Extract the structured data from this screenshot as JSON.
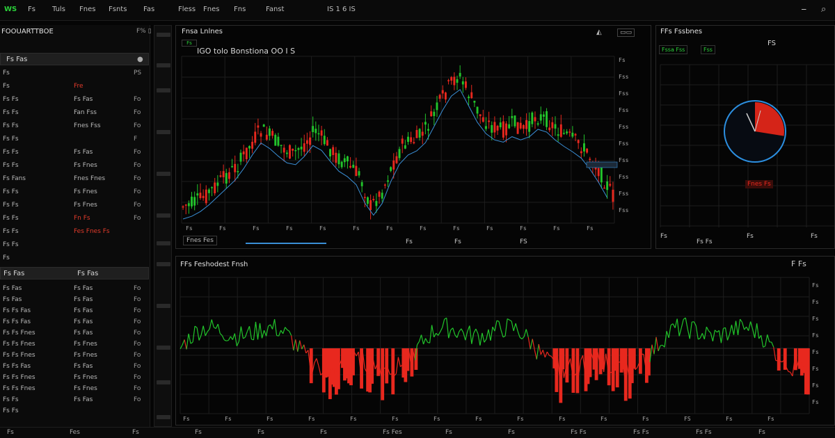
{
  "colors": {
    "up": "#22c52b",
    "down": "#e8281e",
    "accent": "#3a8fd6",
    "panel_border": "#2a2a2a"
  },
  "topbar": {
    "app_label": "WS",
    "menu": [
      "Fs",
      "Tuls",
      "Fnes",
      "Fsnts",
      "Fas",
      "Fless",
      "Fnes",
      "Fns",
      "Fanst",
      "IS 1 6 IS"
    ],
    "minimize_icon": "minimize-icon",
    "close_icon": "close-icon"
  },
  "left_panel": {
    "title": "FOOUARTTBOE",
    "title_right": "F% ▯",
    "section1": {
      "title": "Fs Fas",
      "right": "●"
    },
    "rows1": [
      {
        "c1": "Fs",
        "c2": "",
        "c3": "PS",
        "red": false
      },
      {
        "c1": "Fs",
        "c2": "Fre",
        "c3": "",
        "red": true
      },
      {
        "c1": "Fs Fs",
        "c2": "Fs Fas",
        "c3": "Fo",
        "red": false
      },
      {
        "c1": "Fs Fs",
        "c2": "Fan Fss",
        "c3": "Fo",
        "red": false
      },
      {
        "c1": "Fs Fs",
        "c2": "Fnes Fss",
        "c3": "Fo",
        "red": false
      },
      {
        "c1": "Fs Fs",
        "c2": "",
        "c3": "F",
        "red": false
      },
      {
        "c1": "Fs Fs",
        "c2": "Fs Fas",
        "c3": "Fo",
        "red": false
      },
      {
        "c1": "Fs Fs",
        "c2": "Fs Fnes",
        "c3": "Fo",
        "red": false
      },
      {
        "c1": "Fs Fans",
        "c2": "Fnes Fnes",
        "c3": "Fo",
        "red": false
      },
      {
        "c1": "Fs Fs",
        "c2": "Fs Fnes",
        "c3": "Fo",
        "red": false
      },
      {
        "c1": "Fs Fs",
        "c2": "Fs Fnes",
        "c3": "Fo",
        "red": false
      },
      {
        "c1": "Fs Fs",
        "c2": "Fn Fs",
        "c3": "Fo",
        "red": true
      },
      {
        "c1": "Fs Fs",
        "c2": "Fes Fnes Fs",
        "c3": "",
        "red": true
      },
      {
        "c1": "Fs Fs",
        "c2": "",
        "c3": "",
        "red": false
      },
      {
        "c1": "Fs",
        "c2": "",
        "c3": "",
        "red": false
      }
    ],
    "section2": {
      "title": "Fs Fas",
      "mid": "Fs Fas",
      "right": ""
    },
    "rows2": [
      {
        "c1": "Fs Fas",
        "c2": "Fs Fas",
        "c3": "Fo"
      },
      {
        "c1": "Fs Fas",
        "c2": "Fs Fas",
        "c3": "Fo"
      },
      {
        "c1": "Fs Fs Fas",
        "c2": "Fs Fas",
        "c3": "Fo"
      },
      {
        "c1": "Fs Fs Fas",
        "c2": "Fs Fas",
        "c3": "Fo"
      },
      {
        "c1": "Fs Fs Fnes",
        "c2": "Fs Fas",
        "c3": "Fo"
      },
      {
        "c1": "Fs Fs Fnes",
        "c2": "Fs Fnes",
        "c3": "Fo"
      },
      {
        "c1": "Fs Fs Fnes",
        "c2": "Fs Fnes",
        "c3": "Fo"
      },
      {
        "c1": "Fs Fs Fas",
        "c2": "Fs Fas",
        "c3": "Fo"
      },
      {
        "c1": "Fs Fs Fnes",
        "c2": "Fs Fnes",
        "c3": "Fo"
      },
      {
        "c1": "Fs Fs Fnes",
        "c2": "Fs Fnes",
        "c3": "Fo"
      },
      {
        "c1": "Fs Fs",
        "c2": "Fs Fas",
        "c3": "Fo"
      },
      {
        "c1": "Fs Fs",
        "c2": "",
        "c3": ""
      }
    ]
  },
  "main_chart": {
    "title": "Fnsa Lnlnes",
    "subtitle": "IGO tolo Bonstiona OO I S",
    "badge": "Fs",
    "price_labels": [
      "Fs",
      "Fss",
      "Fss",
      "Fss",
      "Fss",
      "Fss",
      "Fss",
      "Fss",
      "Fss",
      "Fss"
    ],
    "x_labels": [
      "Fs",
      "Fs",
      "Fs",
      "Fs",
      "Fs",
      "Fs",
      "Fs",
      "Fs",
      "Fs",
      "Fs",
      "Fs",
      "Fs",
      "Fs"
    ],
    "footer_tab": "Fnes Fes",
    "footer_labels": [
      "Fs",
      "Fs",
      "FS"
    ]
  },
  "gauge_panel": {
    "title": "FFs Fssbnes",
    "stat1": "Fssa Fss",
    "stat2": "Fss",
    "stat3": "FS",
    "value": "Fnes Fs",
    "footer_labels": [
      "Fs",
      "Fs Fs",
      "Fs",
      "Fs"
    ]
  },
  "volume_chart": {
    "title": "FFs Feshodest Fnsh",
    "corner_label": "F Fs",
    "x_labels": [
      "Fs",
      "Fs",
      "Fs",
      "Fs",
      "Fs",
      "Fs",
      "Fs",
      "Fs",
      "Fs",
      "Fs",
      "Fs",
      "Fs",
      "FS",
      "Fs",
      "Fs"
    ]
  },
  "statusbar": {
    "items": [
      "Fs",
      "Fes",
      "Fs",
      "Fs",
      "Fs",
      "Fs",
      "Fs Fes",
      "Fs",
      "Fs",
      "Fs Fs",
      "Fs Fs",
      "Fs Fs",
      "Fs"
    ]
  }
}
